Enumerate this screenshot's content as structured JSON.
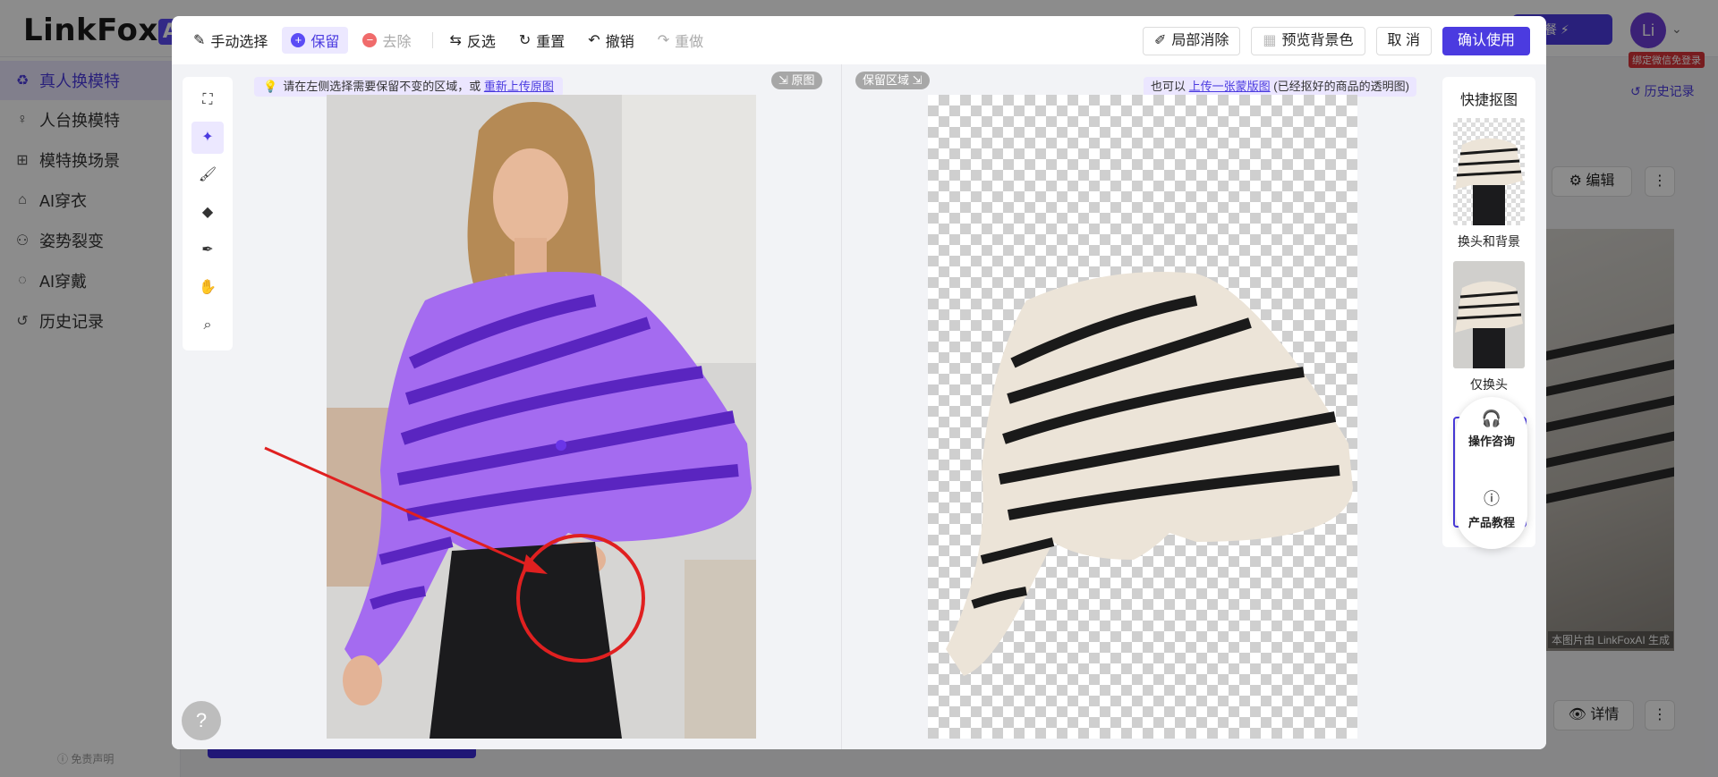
{
  "app": {
    "logo": "LinkFox",
    "logo_badge": "AI",
    "upgrade_label": "套餐 ⚡",
    "avatar_text": "Li",
    "wechat_badge": "绑定微信免登录",
    "history_link": "历史记录",
    "disclaimer": "ⓘ 免责声明",
    "edit_label": "编辑",
    "detail_label": "详情",
    "photo_caption": "本图片由 LinkFoxAI 生成"
  },
  "sidebar": {
    "items": [
      {
        "label": "真人换模特",
        "icon": "model-swap-icon",
        "glyph": "♻",
        "active": true
      },
      {
        "label": "人台换模特",
        "icon": "mannequin-icon",
        "glyph": "♀"
      },
      {
        "label": "模特换场景",
        "icon": "scene-icon",
        "glyph": "⊞"
      },
      {
        "label": "AI穿衣",
        "icon": "shirt-icon",
        "glyph": "⌂"
      },
      {
        "label": "姿势裂变",
        "icon": "pose-icon",
        "glyph": "⚇"
      },
      {
        "label": "AI穿戴",
        "icon": "wear-icon",
        "glyph": "◌"
      },
      {
        "label": "历史记录",
        "icon": "history-icon",
        "glyph": "↺"
      }
    ]
  },
  "modal": {
    "toolbar": {
      "manual_select": "手动选择",
      "keep": "保留",
      "remove": "去除",
      "invert": "反选",
      "reset": "重置",
      "undo": "撤销",
      "redo": "重做",
      "local_erase": "局部消除",
      "preview_bg": "预览背景色",
      "cancel": "取 消",
      "confirm": "确认使用"
    },
    "hint_left_prefix": "请在左侧选择需要保留不变的区域，或",
    "hint_left_link": "重新上传原图",
    "tag_original": "⇲ 原图",
    "tag_keep": "保留区域 ⇲",
    "hint_right_prefix": "也可以",
    "hint_right_link": "上传一张蒙版图",
    "hint_right_suffix": "(已经抠好的商品的透明图)",
    "quick": {
      "title": "快捷抠图",
      "options": [
        {
          "label": "换头和背景"
        },
        {
          "label": "仅换头"
        }
      ]
    },
    "float": {
      "consult": "操作咨询",
      "tutorial": "产品教程"
    },
    "help_glyph": "?"
  },
  "colors": {
    "accent": "#4b3be0",
    "sweater_purple": "#a46bf0",
    "stripe_purple": "#5a25c0",
    "annotation_red": "#e02020"
  }
}
